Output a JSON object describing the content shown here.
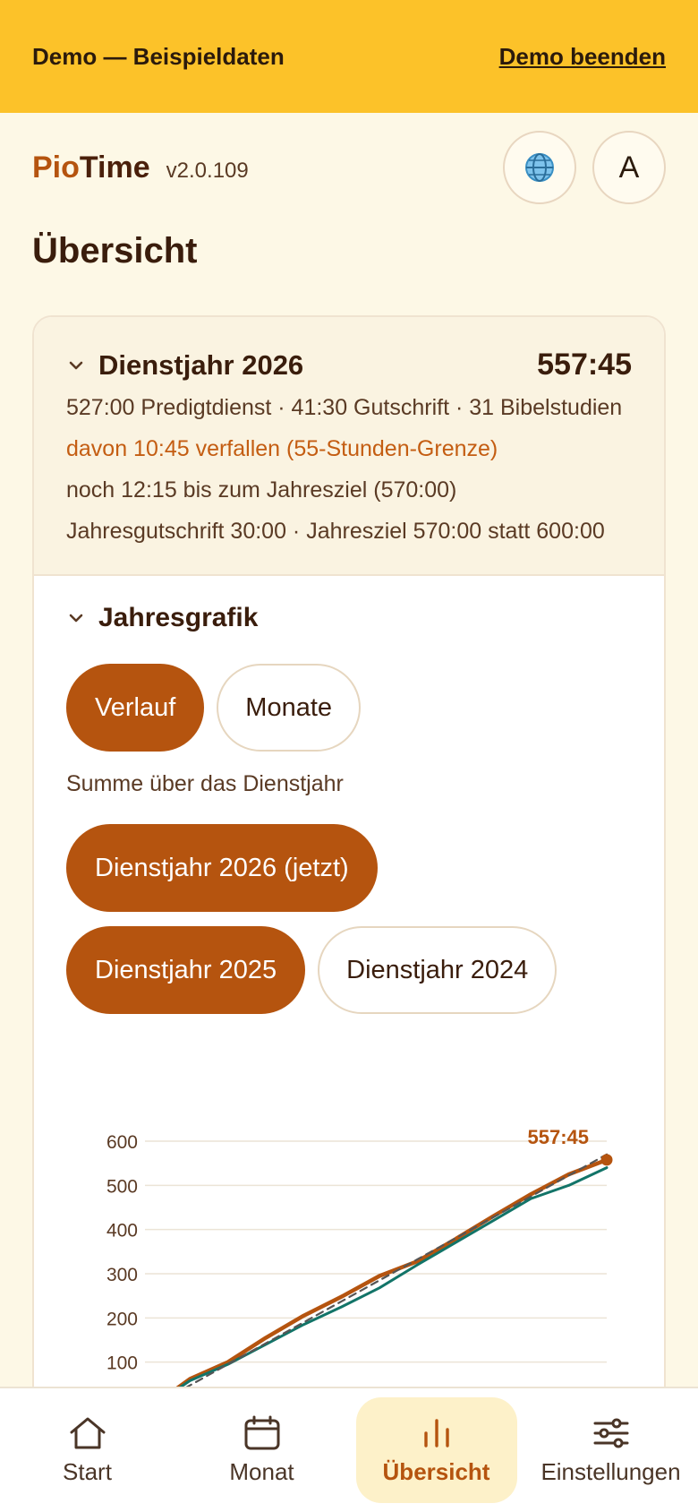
{
  "demo": {
    "label": "Demo — Beispieldaten",
    "end_link": "Demo beenden"
  },
  "brand": {
    "pio": "Pio",
    "time": "Time",
    "version": "v2.0.109"
  },
  "header": {
    "globe_icon": "globe-icon",
    "avatar_letter": "A"
  },
  "page": {
    "title": "Übersicht"
  },
  "year_card": {
    "title": "Dienstjahr 2026",
    "total": "557:45",
    "summary": "527:00 Predigtdienst · 41:30 Gutschrift · 31 Bibelstudien",
    "forfeit": "davon 10:45 verfallen (55-Stunden-Grenze)",
    "remaining": "noch 12:15 bis zum Jahresziel (570:00)",
    "credit": "Jahresgutschrift 30:00 · Jahresziel 570:00 statt 600:00"
  },
  "chart_section": {
    "title": "Jahresgrafik",
    "mode_tabs": [
      {
        "label": "Verlauf",
        "active": true
      },
      {
        "label": "Monate",
        "active": false
      }
    ],
    "subtitle": "Summe über das Dienstjahr",
    "year_chips": [
      {
        "label": "Dienstjahr 2026 (jetzt)",
        "active": true
      },
      {
        "label": "Dienstjahr 2025",
        "active": true
      },
      {
        "label": "Dienstjahr 2024",
        "active": false
      }
    ]
  },
  "chart_data": {
    "type": "line",
    "title": "",
    "xlabel": "",
    "ylabel": "",
    "ylim": [
      0,
      600
    ],
    "yticks": [
      100,
      200,
      300,
      400,
      500,
      600
    ],
    "grid": true,
    "end_label": "557:45",
    "x": [
      0,
      1,
      2,
      3,
      4,
      5,
      6,
      7,
      8,
      9,
      10,
      11,
      12
    ],
    "series": [
      {
        "name": "Dienstjahr 2026 (jetzt)",
        "color": "#b5540f",
        "values": [
          0,
          62,
          100,
          155,
          205,
          248,
          295,
          328,
          378,
          430,
          480,
          525,
          557.75
        ]
      },
      {
        "name": "Dienstjahr 2025",
        "color": "#127468",
        "values": [
          0,
          58,
          95,
          140,
          185,
          225,
          268,
          320,
          370,
          420,
          470,
          500,
          540
        ]
      },
      {
        "name": "Jahresziel",
        "color": "#555555",
        "values": [
          0,
          47.5,
          95,
          142.5,
          190,
          237.5,
          285,
          332.5,
          380,
          427.5,
          475,
          522.5,
          570
        ]
      }
    ]
  },
  "nav": {
    "items": [
      {
        "label": "Start",
        "icon": "home-icon",
        "active": false
      },
      {
        "label": "Monat",
        "icon": "calendar-icon",
        "active": false
      },
      {
        "label": "Übersicht",
        "icon": "bar-chart-icon",
        "active": true
      },
      {
        "label": "Einstellungen",
        "icon": "sliders-icon",
        "active": false
      }
    ]
  },
  "colors": {
    "accent": "#b5540f",
    "banner": "#fcc229",
    "background": "#fdf8e6",
    "secondary_series": "#127468"
  }
}
